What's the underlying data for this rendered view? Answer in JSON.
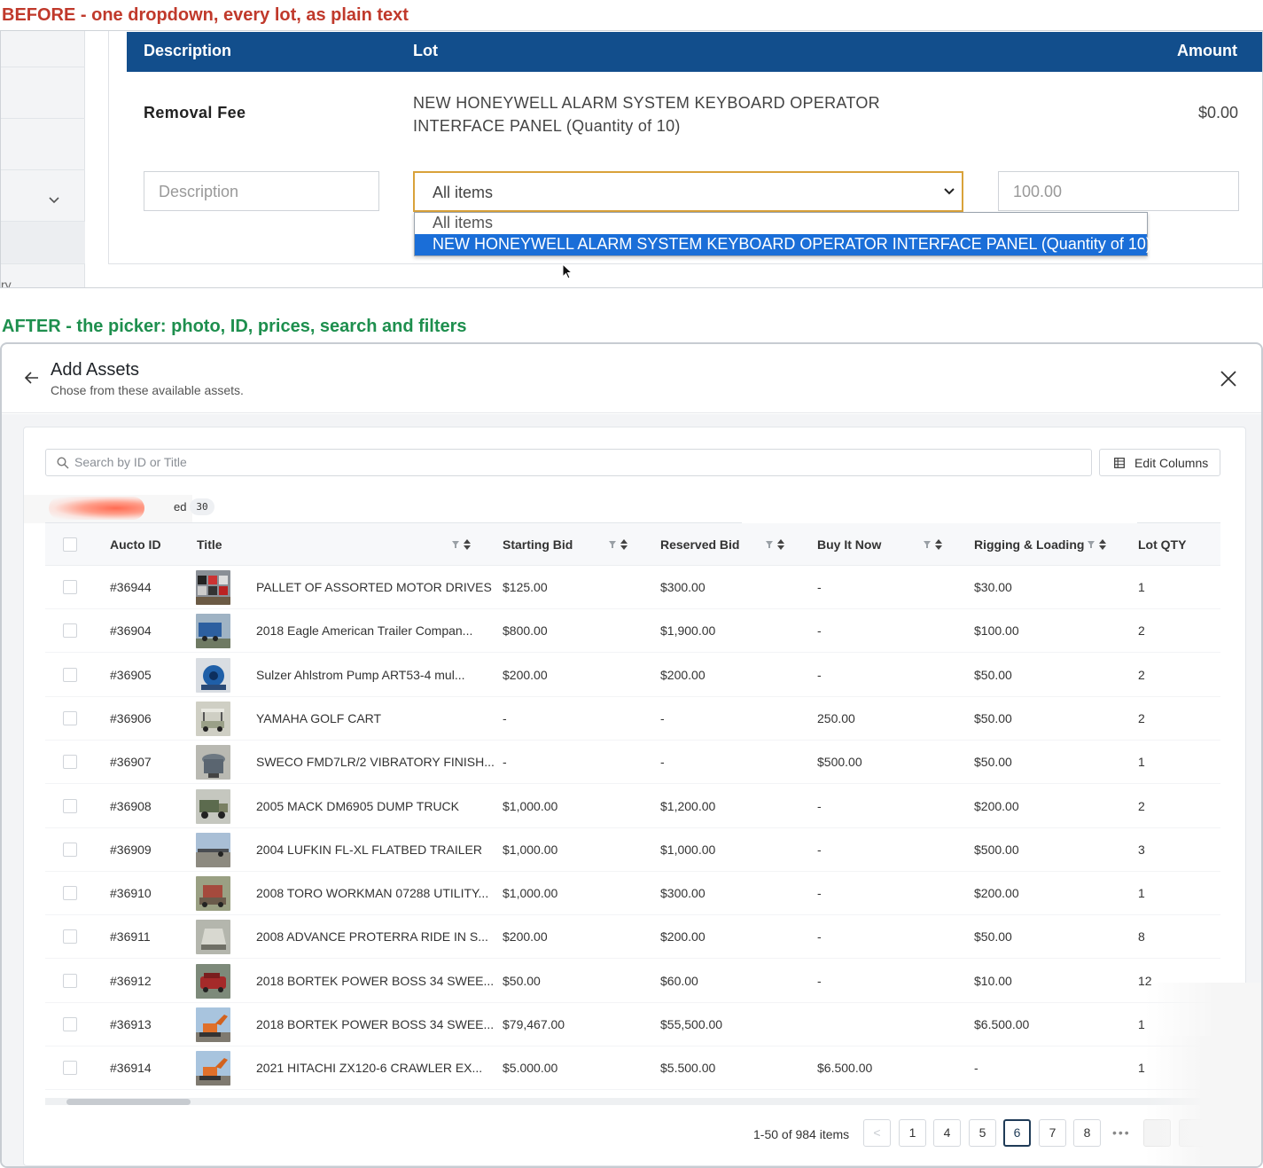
{
  "captions": {
    "before": "BEFORE  -  one dropdown, every lot, as plain text",
    "after": "AFTER  -  the picker: photo, ID, prices, search and filters"
  },
  "before": {
    "headers": {
      "description": "Description",
      "lot": "Lot",
      "amount": "Amount"
    },
    "fee_row": {
      "description": "Removal Fee",
      "lot": "NEW HONEYWELL ALARM SYSTEM KEYBOARD OPERATOR INTERFACE PANEL (Quantity of 10)",
      "amount": "$0.00"
    },
    "edit_row": {
      "description_placeholder": "Description",
      "lot_selected": "All items",
      "amount_placeholder": "100.00"
    },
    "dropdown_options": [
      "All items",
      "NEW HONEYWELL ALARM SYSTEM KEYBOARD OPERATOR INTERFACE PANEL (Quantity of 10)"
    ],
    "sidebar_fragment": "ry"
  },
  "modal": {
    "title": "Add Assets",
    "subtitle": "Chose from these available assets.",
    "search_placeholder": "Search by ID or Title",
    "edit_columns_label": "Edit Columns",
    "tab_label_fragment": "ed",
    "tab_badge": "30",
    "columns": [
      "Aucto ID",
      "Title",
      "Starting Bid",
      "Reserved Bid",
      "Buy It Now",
      "Rigging & Loading",
      "Lot QTY"
    ],
    "rows": [
      {
        "id": "#36944",
        "title": "PALLET OF ASSORTED MOTOR DRIVES",
        "starting": "$125.00",
        "reserved": "$300.00",
        "buy": "-",
        "rigging": "$30.00",
        "qty": "1",
        "thumb": "pallet"
      },
      {
        "id": "#36904",
        "title": "2018 Eagle American Trailer Compan...",
        "starting": "$800.00",
        "reserved": "$1,900.00",
        "buy": "-",
        "rigging": "$100.00",
        "qty": "2",
        "thumb": "trailer"
      },
      {
        "id": "#36905",
        "title": "Sulzer Ahlstrom Pump ART53-4 mul...",
        "starting": "$200.00",
        "reserved": "$200.00",
        "buy": "-",
        "rigging": "$50.00",
        "qty": "2",
        "thumb": "pump"
      },
      {
        "id": "#36906",
        "title": "YAMAHA GOLF CART",
        "starting": "-",
        "reserved": "-",
        "buy": "250.00",
        "rigging": "$50.00",
        "qty": "2",
        "thumb": "cart"
      },
      {
        "id": "#36907",
        "title": "SWECO FMD7LR/2 VIBRATORY FINISH...",
        "starting": "-",
        "reserved": "-",
        "buy": "$500.00",
        "rigging": "$50.00",
        "qty": "1",
        "thumb": "sweco"
      },
      {
        "id": "#36908",
        "title": "2005 MACK  DM6905 DUMP TRUCK",
        "starting": "$1,000.00",
        "reserved": "$1,200.00",
        "buy": "-",
        "rigging": "$200.00",
        "qty": "2",
        "thumb": "truck"
      },
      {
        "id": "#36909",
        "title": "2004 LUFKIN FL-XL FLATBED TRAILER",
        "starting": "$1,000.00",
        "reserved": "$1,000.00",
        "buy": "-",
        "rigging": "$500.00",
        "qty": "3",
        "thumb": "flatbed"
      },
      {
        "id": "#36910",
        "title": "2008 TORO WORKMAN 07288 UTILITY...",
        "starting": "$1,000.00",
        "reserved": "$300.00",
        "buy": "-",
        "rigging": "$200.00",
        "qty": "1",
        "thumb": "toro"
      },
      {
        "id": "#36911",
        "title": "2008 ADVANCE PROTERRA RIDE IN S...",
        "starting": "$200.00",
        "reserved": "$200.00",
        "buy": "-",
        "rigging": "$50.00",
        "qty": "8",
        "thumb": "sweeper"
      },
      {
        "id": "#36912",
        "title": "2018 BORTEK POWER BOSS 34 SWEE...",
        "starting": "$50.00",
        "reserved": "$60.00",
        "buy": "-",
        "rigging": "$10.00",
        "qty": "12",
        "thumb": "redcar"
      },
      {
        "id": "#36913",
        "title": "2018 BORTEK POWER BOSS 34 SWEE...",
        "starting": "$79,467.00",
        "reserved": "$55,500.00",
        "buy": "",
        "rigging": "$6.500.00",
        "qty": "1",
        "thumb": "excavator"
      },
      {
        "id": "#36914",
        "title": "2021 HITACHI ZX120-6 CRAWLER EX...",
        "starting": "$5.000.00",
        "reserved": "$5.500.00",
        "buy": "$6.500.00",
        "rigging": "-",
        "qty": "1",
        "thumb": "excavator"
      }
    ],
    "pagination": {
      "info": "1-50 of 984 items",
      "prev": "<",
      "pages": [
        "1",
        "4",
        "5",
        "6",
        "7",
        "8"
      ],
      "current": "6",
      "ellipsis": "•••"
    }
  },
  "colors": {
    "before_caption": "#c0392b",
    "after_caption": "#1e8f4e",
    "table_header": "#124e8c",
    "dropdown_highlight": "#1a6ed8",
    "select_border": "#d9a23a",
    "active_page": "#1f3b57"
  },
  "icons": {
    "back": "arrow-left-icon",
    "close": "close-icon",
    "search": "search-icon",
    "edit_columns": "grid-columns-icon",
    "sort": "filter-sort-icon",
    "select_caret": "chevron-down-icon",
    "sidebar_chevron": "chevron-down-icon",
    "cursor": "mouse-pointer-icon"
  }
}
